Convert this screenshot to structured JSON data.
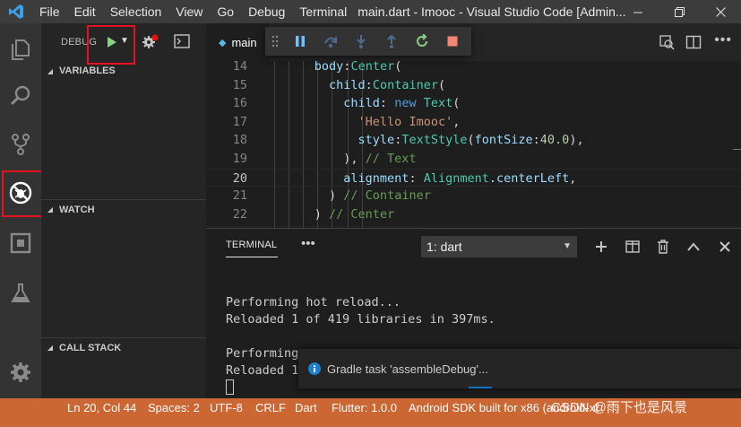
{
  "titlebar": {
    "menu": [
      "File",
      "Edit",
      "Selection",
      "View",
      "Go",
      "Debug",
      "Terminal"
    ],
    "title": "main.dart - Imooc - Visual Studio Code [Admin..."
  },
  "sidebar": {
    "debug_label": "DEBUG",
    "variables_label": "VARIABLES",
    "watch_label": "WATCH",
    "call_stack_label": "CALL STACK"
  },
  "editor": {
    "tab_label": "main",
    "lines": [
      {
        "num": "14",
        "tokens": [
          [
            "pl",
            "      "
          ],
          [
            "prop",
            "body"
          ],
          [
            "pl",
            ":"
          ],
          [
            "cls",
            "Center"
          ],
          [
            "pl",
            "("
          ]
        ]
      },
      {
        "num": "15",
        "tokens": [
          [
            "pl",
            "        "
          ],
          [
            "prop",
            "child"
          ],
          [
            "pl",
            ":"
          ],
          [
            "cls",
            "Container"
          ],
          [
            "pl",
            "("
          ]
        ]
      },
      {
        "num": "16",
        "tokens": [
          [
            "pl",
            "          "
          ],
          [
            "prop",
            "child"
          ],
          [
            "pl",
            ": "
          ],
          [
            "kw",
            "new"
          ],
          [
            "pl",
            " "
          ],
          [
            "cls",
            "Text"
          ],
          [
            "pl",
            "("
          ]
        ]
      },
      {
        "num": "17",
        "tokens": [
          [
            "pl",
            "            "
          ],
          [
            "str",
            "'Hello Imooc'"
          ],
          [
            "pl",
            ","
          ]
        ]
      },
      {
        "num": "18",
        "tokens": [
          [
            "pl",
            "            "
          ],
          [
            "prop",
            "style"
          ],
          [
            "pl",
            ":"
          ],
          [
            "cls",
            "TextStyle"
          ],
          [
            "pl",
            "("
          ],
          [
            "prop",
            "fontSize"
          ],
          [
            "pl",
            ":"
          ],
          [
            "num",
            "40.0"
          ],
          [
            "pl",
            "),"
          ]
        ]
      },
      {
        "num": "19",
        "tokens": [
          [
            "pl",
            "          "
          ],
          [
            "pl",
            "), "
          ],
          [
            "cm",
            "// Text"
          ]
        ]
      },
      {
        "num": "20",
        "tokens": [
          [
            "pl",
            "          "
          ],
          [
            "prop",
            "alignment"
          ],
          [
            "pl",
            ": "
          ],
          [
            "cls",
            "Alignment"
          ],
          [
            "pl",
            "."
          ],
          [
            "prop",
            "centerLeft"
          ],
          [
            "pl",
            ","
          ]
        ]
      },
      {
        "num": "21",
        "tokens": [
          [
            "pl",
            "        "
          ],
          [
            "pl",
            ") "
          ],
          [
            "cm",
            "// Container"
          ]
        ]
      },
      {
        "num": "22",
        "tokens": [
          [
            "pl",
            "      "
          ],
          [
            "pl",
            ") "
          ],
          [
            "cm",
            "// Center"
          ]
        ]
      }
    ],
    "active_line": "20"
  },
  "panel": {
    "terminal_tab": "TERMINAL",
    "more": "•••",
    "terminal_select": "1: dart",
    "output": [
      "Performing hot reload...",
      "Reloaded 1 of 419 libraries in 397ms.",
      "",
      "Performing",
      "Reloaded 1"
    ]
  },
  "notification": {
    "text": "Gradle task 'assembleDebug'..."
  },
  "statusbar": {
    "position": "Ln 20, Col 44",
    "spaces": "Spaces: 2",
    "encoding": "UTF-8",
    "eol": "CRLF",
    "language": "Dart",
    "flutter": "Flutter: 1.0.0",
    "device": "Android SDK built for x86 (android-x86 Emulator)",
    "watermark": "CSDN @雨下也是风景"
  },
  "colors": {
    "statusbar": "#cc6633",
    "highlight": "#e81123",
    "play_green": "#89d185",
    "accent_blue": "#0e70c0"
  }
}
